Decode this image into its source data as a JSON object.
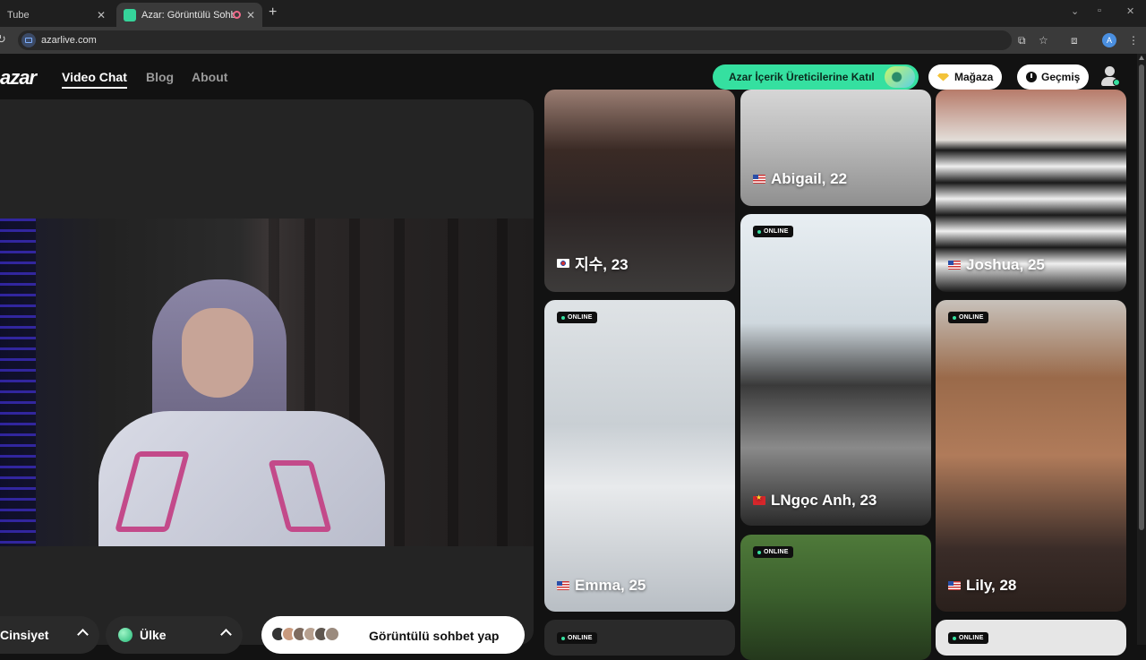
{
  "browser": {
    "tabs": [
      {
        "title": "Tube"
      },
      {
        "title": "Azar: Görüntülü Sohbet & V"
      }
    ],
    "url": "azarlive.com",
    "profile_initial": "A"
  },
  "site": {
    "logo": "azar",
    "nav": [
      "Video Chat",
      "Blog",
      "About"
    ],
    "creator_button": "Azar İçerik Üreticilerine Katıl",
    "shop_button": "Mağaza",
    "history_button": "Geçmiş"
  },
  "controls": {
    "gender_label": "Cinsiyet",
    "country_label": "Ülke",
    "start_label": "Görüntülü sohbet yap"
  },
  "cards": [
    {
      "name": "지수, 23",
      "flag": "kr",
      "online": false
    },
    {
      "name": "Abigail, 22",
      "flag": "us",
      "online": false
    },
    {
      "name": "Joshua, 25",
      "flag": "us",
      "online": false
    },
    {
      "name": "Emma, 25",
      "flag": "us",
      "online": true
    },
    {
      "name": "LNgọc Anh, 23",
      "flag": "vn",
      "online": true
    },
    {
      "name": "Lily, 28",
      "flag": "us",
      "online": true
    },
    {
      "name": "",
      "flag": "",
      "online": true
    },
    {
      "name": "",
      "flag": "",
      "online": true
    },
    {
      "name": "",
      "flag": "",
      "online": true
    }
  ],
  "online_label": "ONLINE",
  "colors": {
    "accent": "#35e0a0",
    "background": "#121212",
    "panel": "#242424"
  }
}
